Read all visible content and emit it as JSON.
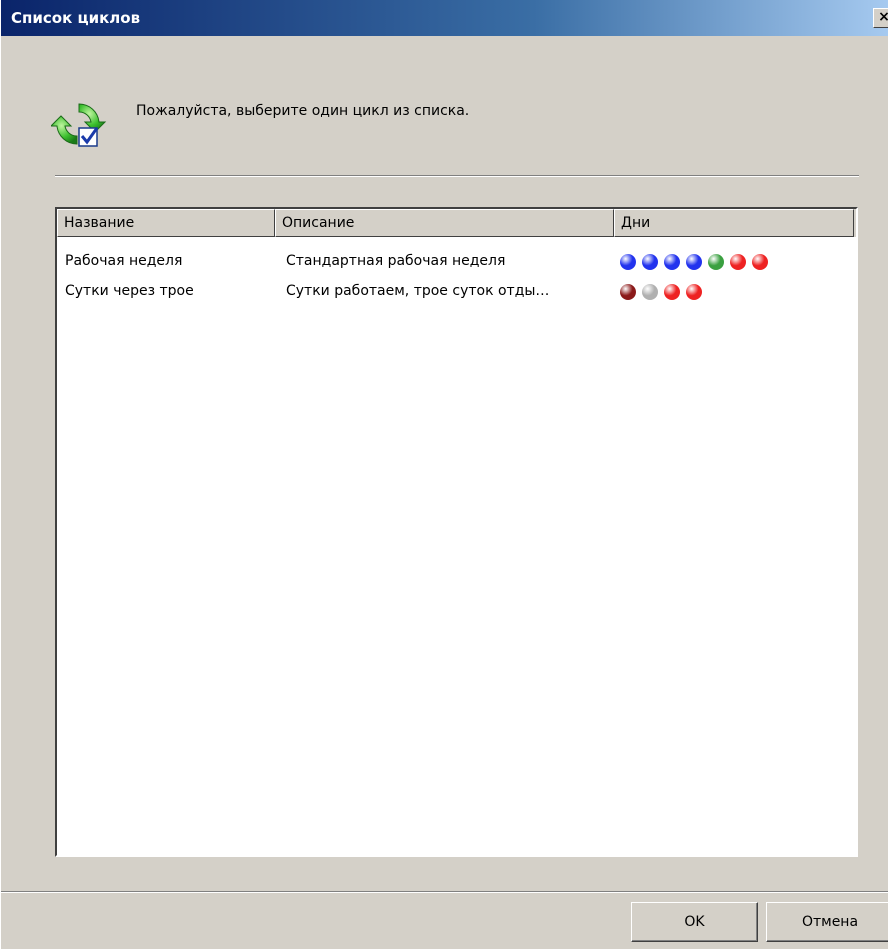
{
  "window": {
    "title": "Список циклов",
    "close_label": "×"
  },
  "header": {
    "prompt": "Пожалуйста, выберите один цикл из списка.",
    "icon": "cycle-refresh-check-icon"
  },
  "list": {
    "columns": [
      "Название",
      "Описание",
      "Дни"
    ],
    "rows": [
      {
        "name": "Рабочая неделя",
        "description": "Стандартная рабочая неделя",
        "days": [
          "#2233ee",
          "#2233ee",
          "#2233ee",
          "#2233ee",
          "#3aa040",
          "#ee2222",
          "#ee2222"
        ]
      },
      {
        "name": "Сутки через трое",
        "description": "Сутки работаем, трое суток отды…",
        "days": [
          "#8b1a1a",
          "#b0b0b0",
          "#ee2222",
          "#ee2222"
        ]
      }
    ]
  },
  "buttons": {
    "ok": "OK",
    "cancel": "Отмена"
  }
}
